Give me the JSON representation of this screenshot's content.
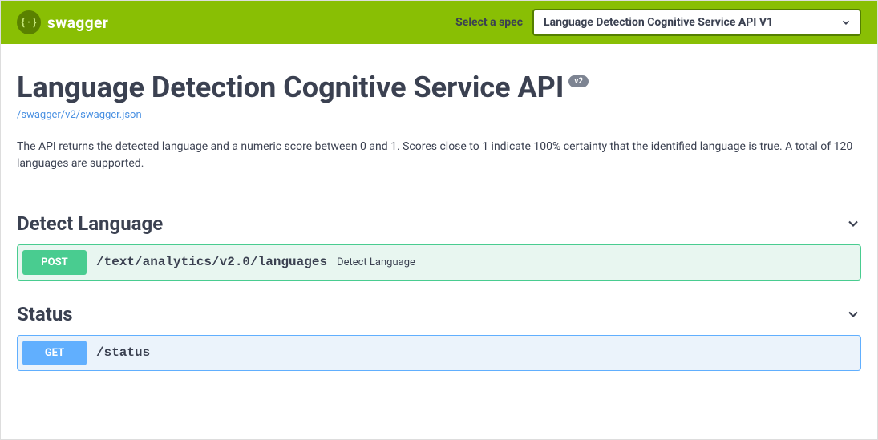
{
  "topbar": {
    "brand": "swagger",
    "select_label": "Select a spec",
    "spec_selected": "Language Detection Cognitive Service API V1"
  },
  "info": {
    "title": "Language Detection Cognitive Service API",
    "version": "v2",
    "json_url": "/swagger/v2/swagger.json",
    "description": "The API returns the detected language and a numeric score between 0 and 1. Scores close to 1 indicate 100% certainty that the identified language is true. A total of 120 languages are supported."
  },
  "tags": [
    {
      "name": "Detect Language",
      "operations": [
        {
          "method": "POST",
          "path": "/text/analytics/v2.0/languages",
          "summary": "Detect Language"
        }
      ]
    },
    {
      "name": "Status",
      "operations": [
        {
          "method": "GET",
          "path": "/status",
          "summary": ""
        }
      ]
    }
  ]
}
